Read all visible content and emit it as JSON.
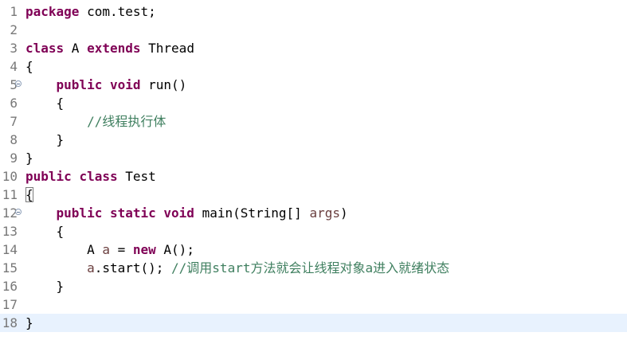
{
  "colors": {
    "keyword": "#7f0055",
    "comment": "#3f7f5f",
    "variable": "#6a3e3e",
    "line_number": "#787878",
    "current_line": "#e8f2fe"
  },
  "lines": [
    {
      "n": "1",
      "indent": "",
      "tokens": [
        {
          "t": "package",
          "c": "kw"
        },
        {
          "t": " com.test;"
        }
      ]
    },
    {
      "n": "2",
      "indent": "",
      "tokens": []
    },
    {
      "n": "3",
      "indent": "",
      "tokens": [
        {
          "t": "class",
          "c": "kw"
        },
        {
          "t": " A "
        },
        {
          "t": "extends",
          "c": "kw"
        },
        {
          "t": " Thread"
        }
      ]
    },
    {
      "n": "4",
      "indent": "",
      "tokens": [
        {
          "t": "{"
        }
      ]
    },
    {
      "n": "5",
      "fold": true,
      "indent": "    ",
      "tokens": [
        {
          "t": "public",
          "c": "kw"
        },
        {
          "t": " "
        },
        {
          "t": "void",
          "c": "kw"
        },
        {
          "t": " run()"
        }
      ]
    },
    {
      "n": "6",
      "indent": "    ",
      "tokens": [
        {
          "t": "{"
        }
      ]
    },
    {
      "n": "7",
      "indent": "        ",
      "tokens": [
        {
          "t": "//线程执行体",
          "c": "cm"
        }
      ]
    },
    {
      "n": "8",
      "indent": "    ",
      "tokens": [
        {
          "t": "}"
        }
      ]
    },
    {
      "n": "9",
      "indent": "",
      "tokens": [
        {
          "t": "}"
        }
      ]
    },
    {
      "n": "10",
      "indent": "",
      "tokens": [
        {
          "t": "public",
          "c": "kw"
        },
        {
          "t": " "
        },
        {
          "t": "class",
          "c": "kw"
        },
        {
          "t": " Test"
        }
      ]
    },
    {
      "n": "11",
      "indent": "",
      "tokens": [
        {
          "t": "{",
          "c": "brace-box"
        }
      ]
    },
    {
      "n": "12",
      "fold": true,
      "indent": "    ",
      "tokens": [
        {
          "t": "public",
          "c": "kw"
        },
        {
          "t": " "
        },
        {
          "t": "static",
          "c": "kw"
        },
        {
          "t": " "
        },
        {
          "t": "void",
          "c": "kw"
        },
        {
          "t": " main(String[] "
        },
        {
          "t": "args",
          "c": "var"
        },
        {
          "t": ")"
        }
      ]
    },
    {
      "n": "13",
      "indent": "    ",
      "tokens": [
        {
          "t": "{"
        }
      ]
    },
    {
      "n": "14",
      "indent": "        ",
      "tokens": [
        {
          "t": "A "
        },
        {
          "t": "a",
          "c": "var"
        },
        {
          "t": " = "
        },
        {
          "t": "new",
          "c": "kw"
        },
        {
          "t": " A();"
        }
      ]
    },
    {
      "n": "15",
      "indent": "        ",
      "tokens": [
        {
          "t": "a",
          "c": "var"
        },
        {
          "t": ".start(); "
        },
        {
          "t": "//调用start方法就会让线程对象a进入就绪状态",
          "c": "cm"
        }
      ]
    },
    {
      "n": "16",
      "indent": "    ",
      "tokens": [
        {
          "t": "}"
        }
      ]
    },
    {
      "n": "17",
      "indent": "",
      "tokens": []
    },
    {
      "n": "18",
      "current": true,
      "indent": "",
      "tokens": [
        {
          "t": "}"
        }
      ]
    }
  ]
}
